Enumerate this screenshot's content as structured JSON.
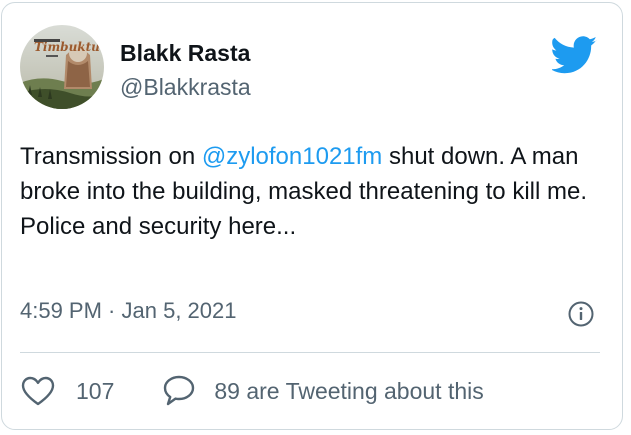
{
  "tweet": {
    "author": {
      "display_name": "Blakk Rasta",
      "handle": "@Blakkrasta",
      "avatar_icon": "avatar-image-icon"
    },
    "text": {
      "before_mention": "Transmission on ",
      "mention": "@zylofon1021fm",
      "after_mention": "  shut down. A man broke into the building, masked threatening to kill me. Police and security here..."
    },
    "time": "4:59 PM",
    "separator": " · ",
    "date": "Jan 5, 2021",
    "likes": "107",
    "reply_text": "89 are Tweeting about this"
  },
  "colors": {
    "brand": "#1d9bf0",
    "secondary_text": "#536471",
    "border": "#cfd9de"
  },
  "icons": {
    "logo": "twitter-bird-icon",
    "info": "info-icon",
    "like": "heart-icon",
    "reply": "speech-bubble-icon"
  }
}
